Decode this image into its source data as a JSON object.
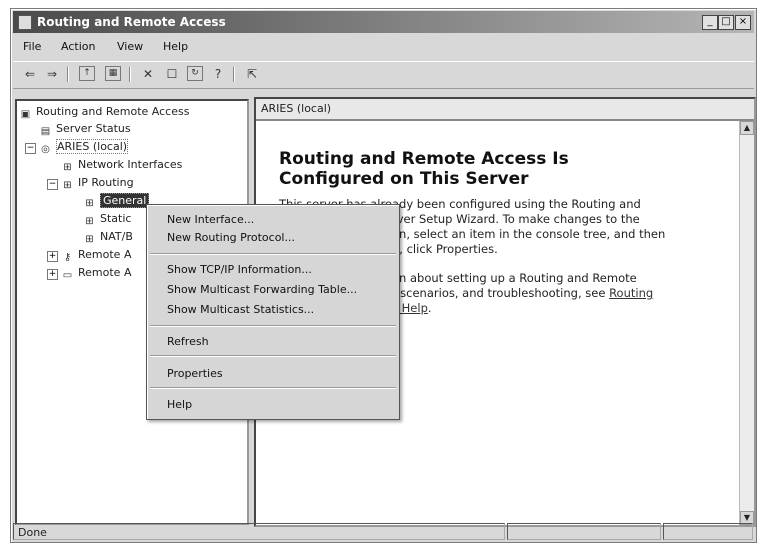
{
  "window": {
    "title": "Routing and Remote Access"
  },
  "menubar": [
    "File",
    "Action",
    "View",
    "Help"
  ],
  "toolbar": [
    "back-arrow-icon",
    "forward-arrow-icon",
    "up-folder-icon",
    "show-hide-tree-icon",
    "delete-icon",
    "properties-icon",
    "refresh-icon",
    "export-list-icon"
  ],
  "tree": {
    "root": "Routing and Remote Access",
    "server_status": "Server Status",
    "server": "ARIES (local)",
    "network_interfaces": "Network Interfaces",
    "ip_routing": "IP Routing",
    "general": "General",
    "static": "Static",
    "nat": "NAT/B",
    "remote_access_1": "Remote A",
    "remote_access_2": "Remote A"
  },
  "right_pane": {
    "header": "ARIES (local)",
    "heading_line1": "Routing and Remote Access Is",
    "heading_line2": "Configured on This Server",
    "p1_l1": "This server has already been configured using the Routing and",
    "p1_l2": "rver Setup Wizard. To make changes to the",
    "p1_l3": "on, select an item in the console tree, and then",
    "p1_l4": "n, click Properties.",
    "p2_l1": "on about setting up a Routing and Remote",
    "p2_l2": "t scenarios, and troubleshooting, see",
    "p2_link1": "Routing",
    "p2_link2": "s Help",
    "p2_end": "."
  },
  "context_menu": {
    "new_interface": "New Interface...",
    "new_routing_protocol": "New Routing Protocol...",
    "show_tcpip": "Show TCP/IP Information...",
    "show_multicast_fwd": "Show Multicast Forwarding Table...",
    "show_multicast_stats": "Show Multicast Statistics...",
    "refresh": "Refresh",
    "properties": "Properties",
    "help": "Help"
  },
  "status": {
    "text": "Done"
  }
}
